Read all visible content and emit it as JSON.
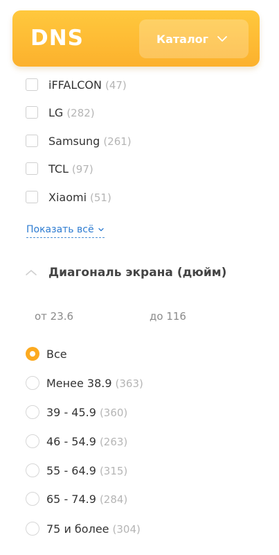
{
  "header": {
    "logo_text": "DNS",
    "catalog_label": "Каталог",
    "catalog_icon": "chevron-down-icon",
    "brand_color": "#fcb12d"
  },
  "brand_filter": {
    "items": [
      {
        "label": "iFFALCON",
        "count": "(47)"
      },
      {
        "label": "LG",
        "count": "(282)"
      },
      {
        "label": "Samsung",
        "count": "(261)"
      },
      {
        "label": "TCL",
        "count": "(97)"
      },
      {
        "label": "Xiaomi",
        "count": "(51)"
      }
    ],
    "show_all_label": "Показать всё"
  },
  "diagonal_filter": {
    "title": "Диагональ экрана (дюйм)",
    "collapse_icon": "chevron-up-icon",
    "from_placeholder": "от 23.6",
    "to_placeholder": "до 116",
    "options": [
      {
        "label": "Все",
        "count": "",
        "selected": true
      },
      {
        "label": "Менее 38.9",
        "count": "(363)",
        "selected": false
      },
      {
        "label": "39 - 45.9",
        "count": "(360)",
        "selected": false
      },
      {
        "label": "46 - 54.9",
        "count": "(263)",
        "selected": false
      },
      {
        "label": "55 - 64.9",
        "count": "(315)",
        "selected": false
      },
      {
        "label": "65 - 74.9",
        "count": "(284)",
        "selected": false
      },
      {
        "label": "75 и более",
        "count": "(304)",
        "selected": false
      }
    ]
  },
  "colors": {
    "accent": "#fcaa20",
    "link": "#2e7cd1",
    "count_gray": "#b5b5b5"
  }
}
